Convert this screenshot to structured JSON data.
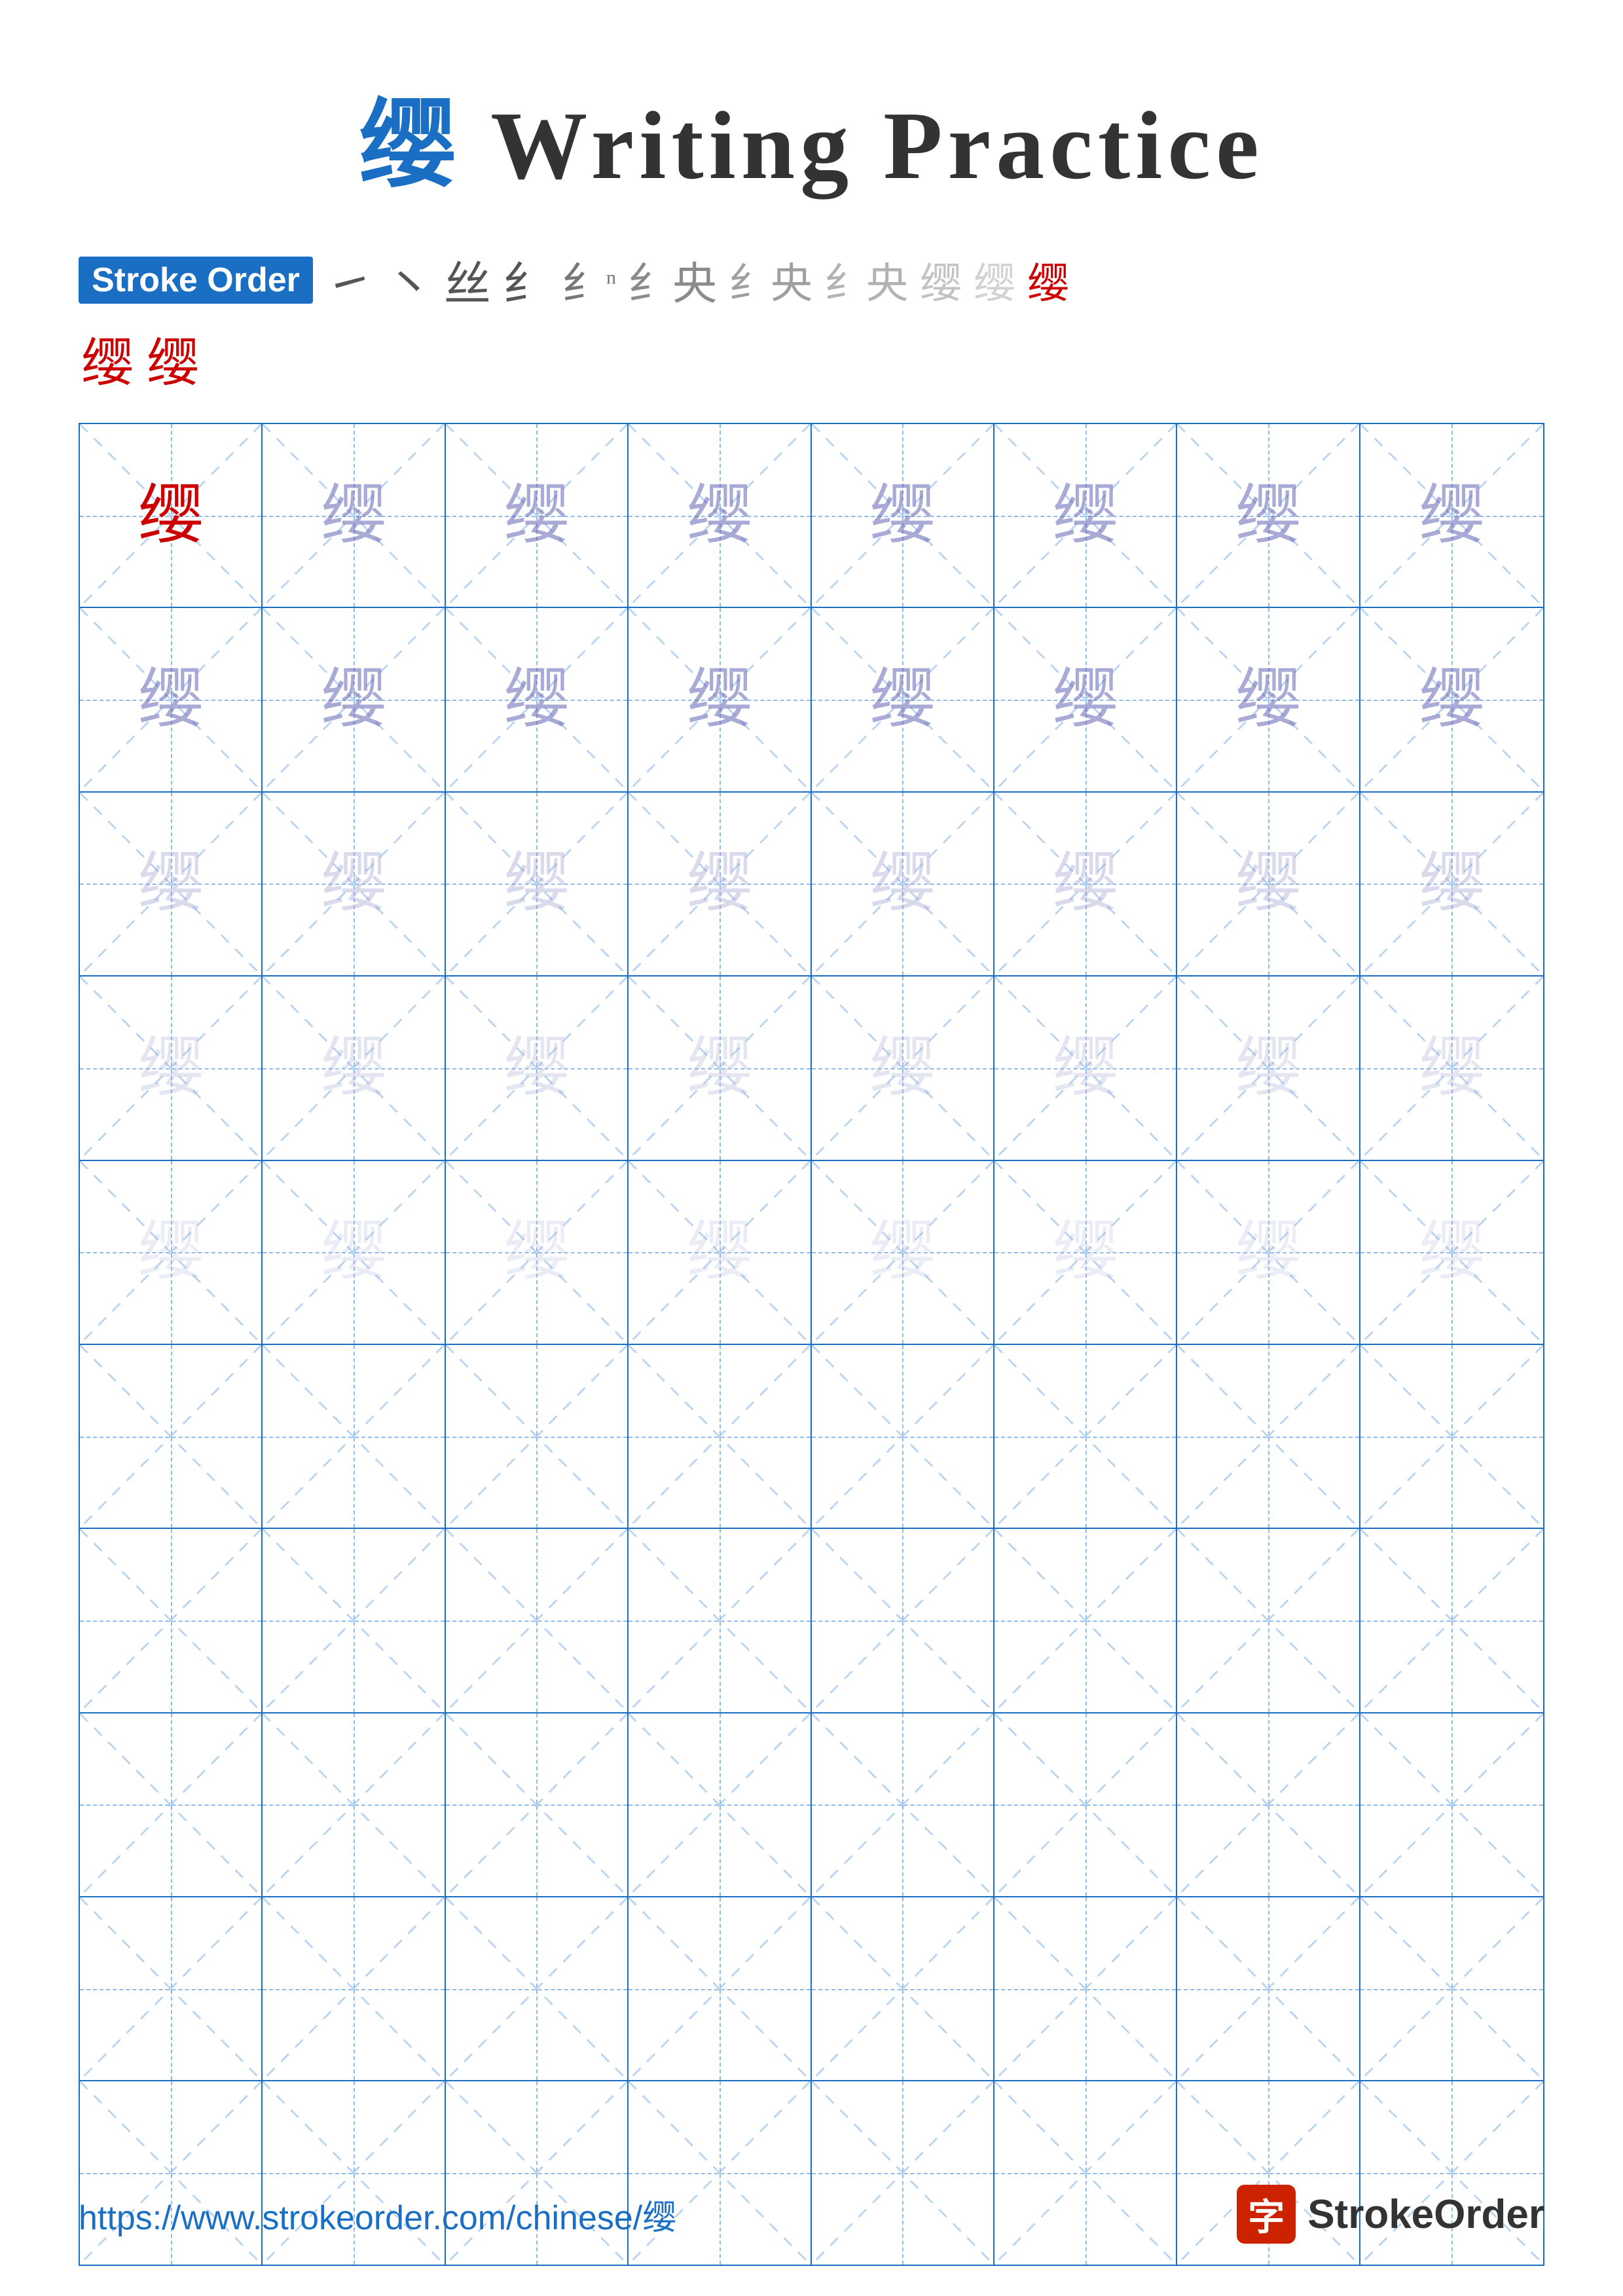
{
  "title": {
    "char": "缨",
    "text": " Writing Practice"
  },
  "stroke_order": {
    "label": "Stroke Order",
    "strokes": [
      "㇀",
      "㇔",
      "㇠",
      "㇢",
      "㇣",
      "缨",
      "缨",
      "缨",
      "缨",
      "缨",
      "缨",
      "缨"
    ],
    "extra": [
      "缨",
      "缨"
    ]
  },
  "grid": {
    "rows": 10,
    "cols": 8,
    "char": "缨",
    "filled_rows": 5,
    "empty_rows": 5
  },
  "footer": {
    "url": "https://www.strokeorder.com/chinese/缨",
    "brand_char": "字",
    "brand_name": "StrokeOrder"
  }
}
